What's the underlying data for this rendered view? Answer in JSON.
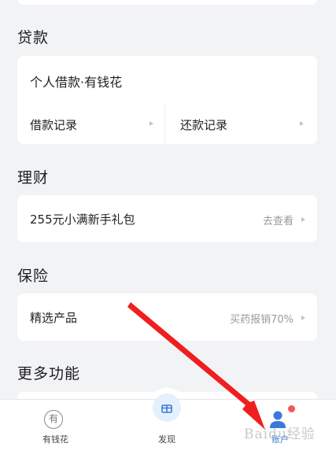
{
  "sections": {
    "loan": {
      "title": "贷款",
      "product": "个人借款·有钱花",
      "left_link": "借款记录",
      "right_link": "还款记录"
    },
    "finance": {
      "title": "理财",
      "item": "255元小满新手礼包",
      "hint": "去查看"
    },
    "insurance": {
      "title": "保险",
      "item": "精选产品",
      "hint": "买药报销70%"
    },
    "more": {
      "title": "更多功能"
    }
  },
  "nav": {
    "items": [
      {
        "label": "有钱花",
        "icon": "有"
      },
      {
        "label": "发现"
      },
      {
        "label": "账户"
      }
    ]
  },
  "watermark": "Baidu经验",
  "colors": {
    "accent": "#3b78d8",
    "arrow": "#f01e1e",
    "badge": "#f25757"
  }
}
